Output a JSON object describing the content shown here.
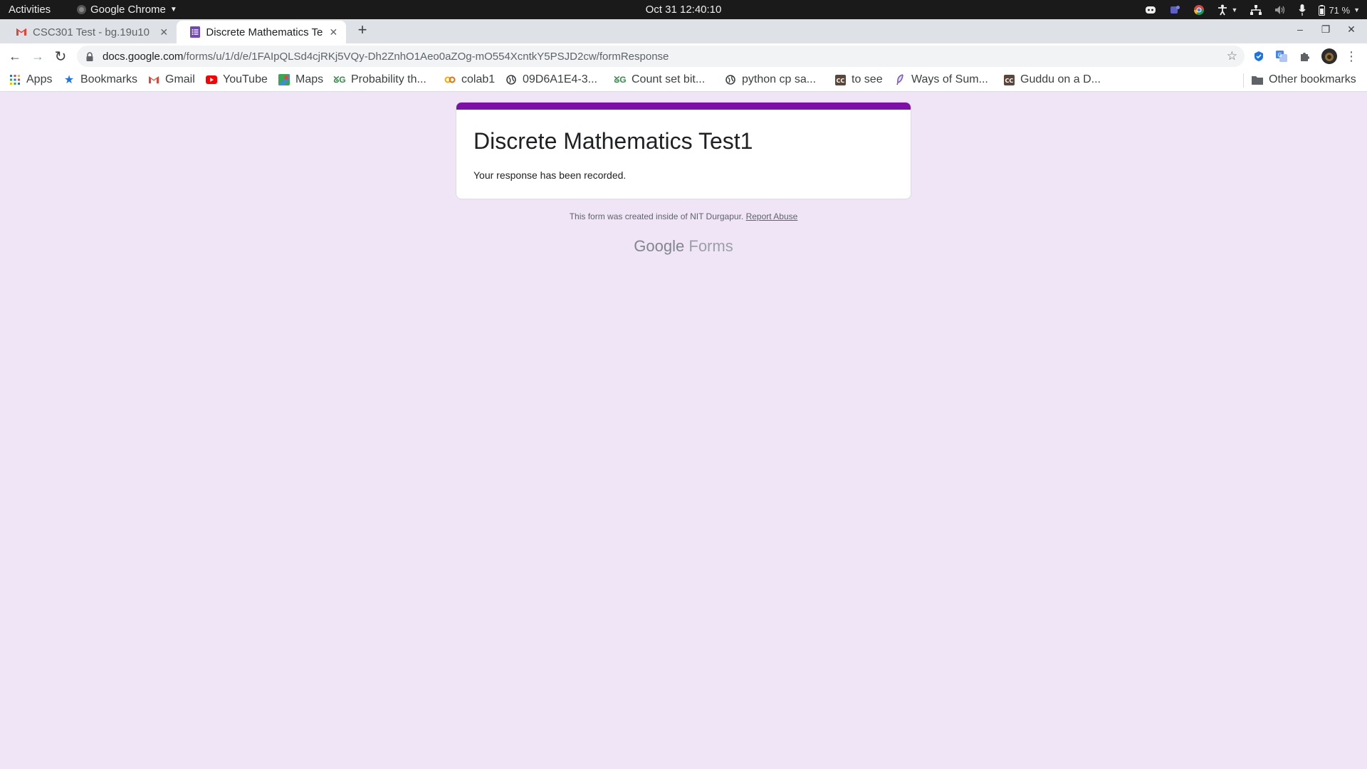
{
  "system": {
    "activities": "Activities",
    "app_menu": "Google Chrome",
    "clock": "Oct 31  12:40:10",
    "battery": "71 %"
  },
  "tabs": [
    {
      "title": "CSC301 Test - bg.19u10",
      "close": "✕"
    },
    {
      "title": "Discrete Mathematics Te",
      "close": "✕"
    }
  ],
  "newtab": "+",
  "window_controls": {
    "minimize": "–",
    "maximize": "❐",
    "close": "✕"
  },
  "toolbar": {
    "back": "←",
    "forward": "→",
    "reload": "↻",
    "url_host": "docs.google.com",
    "url_path": "/forms/u/1/d/e/1FAIpQLSd4cjRKj5VQy-Dh2ZnhO1Aeo0aZOg-mO554XcntkY5PSJD2cw/formResponse",
    "star": "☆",
    "menu": "⋮"
  },
  "bookmarks": [
    {
      "label": "Apps",
      "icon": "apps-grid-icon"
    },
    {
      "label": "Bookmarks",
      "icon": "star-icon"
    },
    {
      "label": "Gmail",
      "icon": "gmail-icon"
    },
    {
      "label": "YouTube",
      "icon": "youtube-icon"
    },
    {
      "label": "Maps",
      "icon": "maps-icon"
    },
    {
      "label": "Probability th...",
      "icon": "gfg-icon"
    },
    {
      "label": "colab1",
      "icon": "colab-icon"
    },
    {
      "label": "09D6A1E4-3...",
      "icon": "globe-icon"
    },
    {
      "label": "Count set bit...",
      "icon": "gfg-icon"
    },
    {
      "label": "python cp sa...",
      "icon": "globe-icon"
    },
    {
      "label": "to see",
      "icon": "codechef-icon"
    },
    {
      "label": "Ways of Sum...",
      "icon": "feather-icon"
    },
    {
      "label": "Guddu on a D...",
      "icon": "codechef-icon"
    }
  ],
  "other_bookmarks": "Other bookmarks",
  "form": {
    "title": "Discrete Mathematics Test1",
    "message": "Your response has been recorded.",
    "accent_color": "#7e0fa8",
    "background_color": "#f0e4f7"
  },
  "footer": {
    "note": "This form was created inside of NIT Durgapur.",
    "report_link": "Report Abuse",
    "brand_google": "Google",
    "brand_forms": "Forms"
  }
}
